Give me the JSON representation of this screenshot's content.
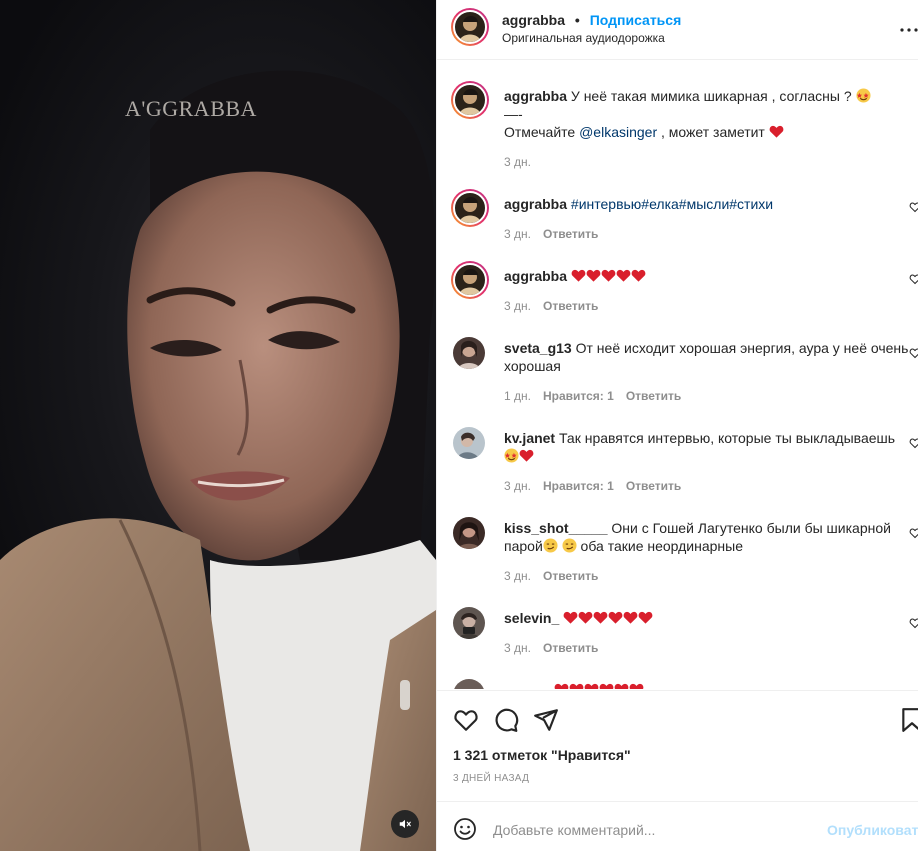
{
  "post": {
    "watermark": "A'GGRABBA",
    "author": "aggrabba",
    "separator": "•",
    "follow_label": "Подписаться",
    "audio_label": "Оригинальная аудиодорожка"
  },
  "caption": {
    "username": "aggrabba",
    "line1": "У неё такая мимика шикарная , согласны ?",
    "line2": "—-",
    "line3_prefix": "Отмечайте",
    "mention": "@elkasinger",
    "line3_suffix": ", может заметит",
    "time": "3 дн."
  },
  "comments": [
    {
      "username": "aggrabba",
      "text": "#интервью#елка#мысли#стихи",
      "time": "3 дн.",
      "likes": "",
      "reply": "Ответить"
    },
    {
      "username": "aggrabba",
      "text": "",
      "time": "3 дн.",
      "likes": "",
      "reply": "Ответить"
    },
    {
      "username": "sveta_g13",
      "text": "От неё исходит хорошая энергия, аура у неё очень хорошая",
      "time": "1 дн.",
      "likes": "Нравится: 1",
      "reply": "Ответить"
    },
    {
      "username": "kv.janet",
      "text": "Так нравятся интервью, которые ты выкладываешь",
      "time": "3 дн.",
      "likes": "Нравится: 1",
      "reply": "Ответить"
    },
    {
      "username": "kiss_shot_____",
      "text": "Они с Гошей Лагутенко были бы шикарной",
      "text2a": "парой",
      "text2b": "оба такие неординарные",
      "time": "3 дн.",
      "likes": "",
      "reply": "Ответить"
    },
    {
      "username": "selevin_",
      "text": "",
      "time": "3 дн.",
      "likes": "",
      "reply": "Ответить"
    }
  ],
  "footer": {
    "likes_text": "1 321 отметок \"Нравится\"",
    "posted_ago": "3 ДНЕЙ НАЗАД",
    "comment_placeholder": "Добавьте комментарий...",
    "publish_label": "Опубликовать"
  },
  "icons": [
    "heart-icon",
    "comment-icon",
    "share-icon",
    "bookmark-icon",
    "more-icon",
    "mute-icon",
    "emoji-icon"
  ],
  "colors": {
    "accent": "#0095f6",
    "heart": "#ed4956",
    "muted": "#8e8e8e"
  }
}
